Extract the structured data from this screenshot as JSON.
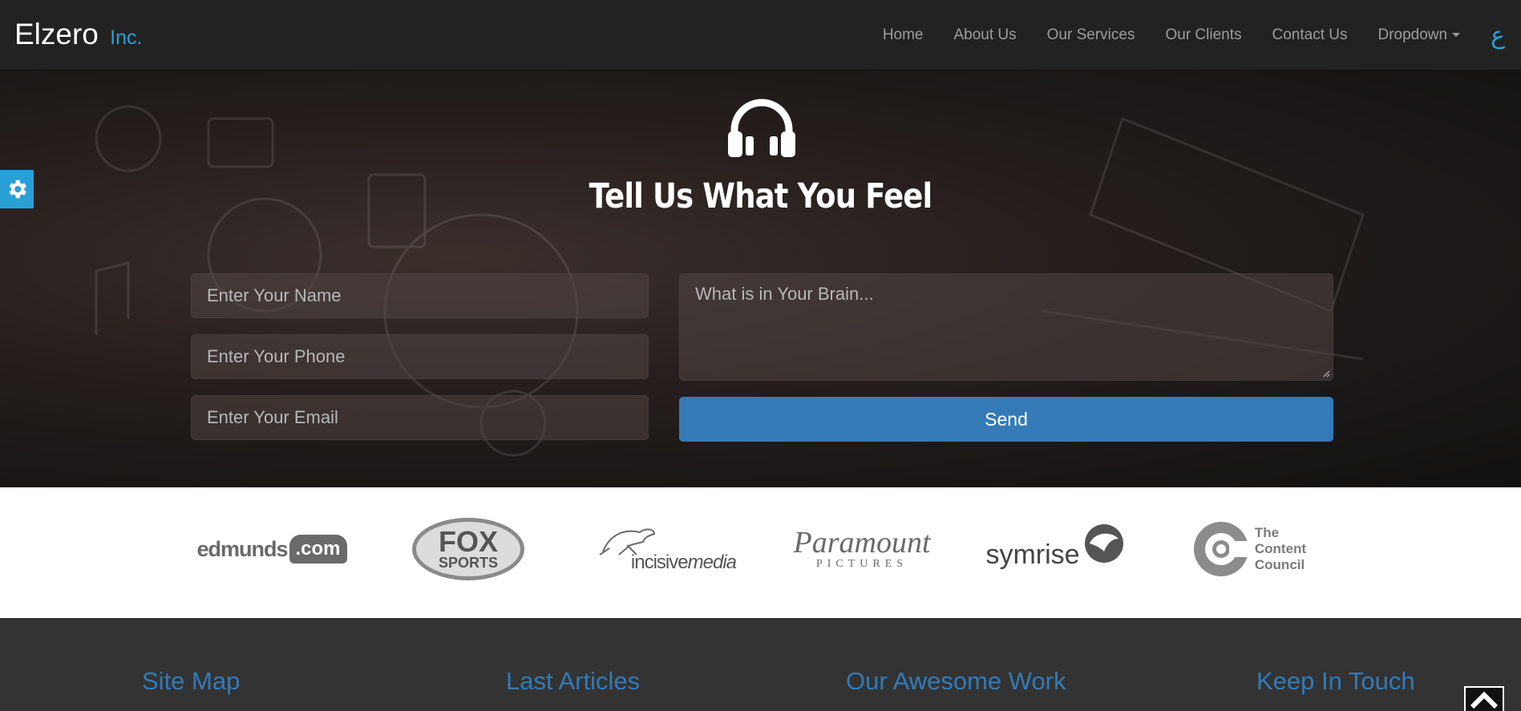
{
  "brand": {
    "name": "Elzero",
    "suffix": "Inc."
  },
  "nav": {
    "items": [
      "Home",
      "About Us",
      "Our Services",
      "Our Clients",
      "Contact Us",
      "Dropdown"
    ],
    "lang_toggle": "ع"
  },
  "settings": {
    "icon": "gear-icon"
  },
  "contact": {
    "icon": "headphones-icon",
    "title": "Tell Us What You Feel",
    "name_placeholder": "Enter Your Name",
    "phone_placeholder": "Enter Your Phone",
    "email_placeholder": "Enter Your Email",
    "message_placeholder": "What is in Your Brain...",
    "send_label": "Send"
  },
  "clients": {
    "logos": [
      {
        "name": "edmunds-logo",
        "text": "edmunds",
        "badge": ".com"
      },
      {
        "name": "fox-sports-logo",
        "text": "FOX",
        "sub": "SPORTS"
      },
      {
        "name": "incisivemedia-logo",
        "text": "incisive",
        "sub": "media"
      },
      {
        "name": "paramount-logo",
        "text": "Paramount",
        "sub": "PICTURES"
      },
      {
        "name": "symrise-logo",
        "text": "symrise"
      },
      {
        "name": "content-council-logo",
        "lines": [
          "The",
          "Content",
          "Council"
        ]
      }
    ]
  },
  "footer": {
    "headings": [
      "Site Map",
      "Last Articles",
      "Our Awesome Work",
      "Keep In Touch"
    ]
  },
  "colors": {
    "accent": "#2a9fd6",
    "button": "#337ab7",
    "navbar": "#222222",
    "footer": "#333333"
  }
}
